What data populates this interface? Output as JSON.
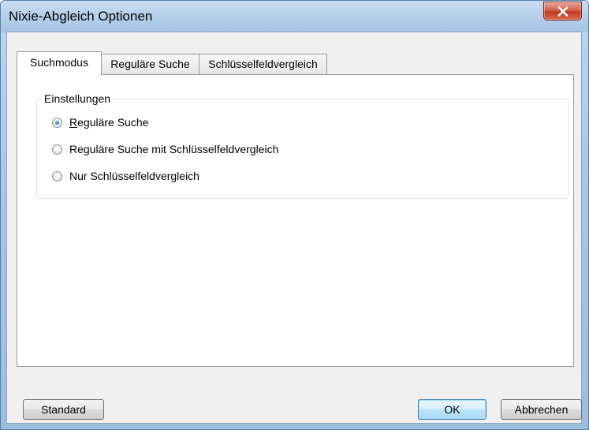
{
  "window": {
    "title": "Nixie-Abgleich Optionen",
    "close_label": "X"
  },
  "tabs": [
    {
      "label": "Suchmodus",
      "active": true
    },
    {
      "label": "Reguläre Suche",
      "active": false
    },
    {
      "label": "Schlüsselfeldvergleich",
      "active": false
    }
  ],
  "group": {
    "label": "Einstellungen",
    "options": [
      {
        "mnemonic": "R",
        "label_rest": "eguläre Suche",
        "checked": true
      },
      {
        "label": "Reguläre Suche mit Schlüsselfeldvergleich",
        "checked": false
      },
      {
        "label": "Nur Schlüsselfeldvergleich",
        "checked": false
      }
    ]
  },
  "buttons": {
    "standard": "Standard",
    "ok": "OK",
    "cancel": "Abbrechen"
  },
  "colors": {
    "accent": "#2a7fd4",
    "close": "#c13b22"
  }
}
